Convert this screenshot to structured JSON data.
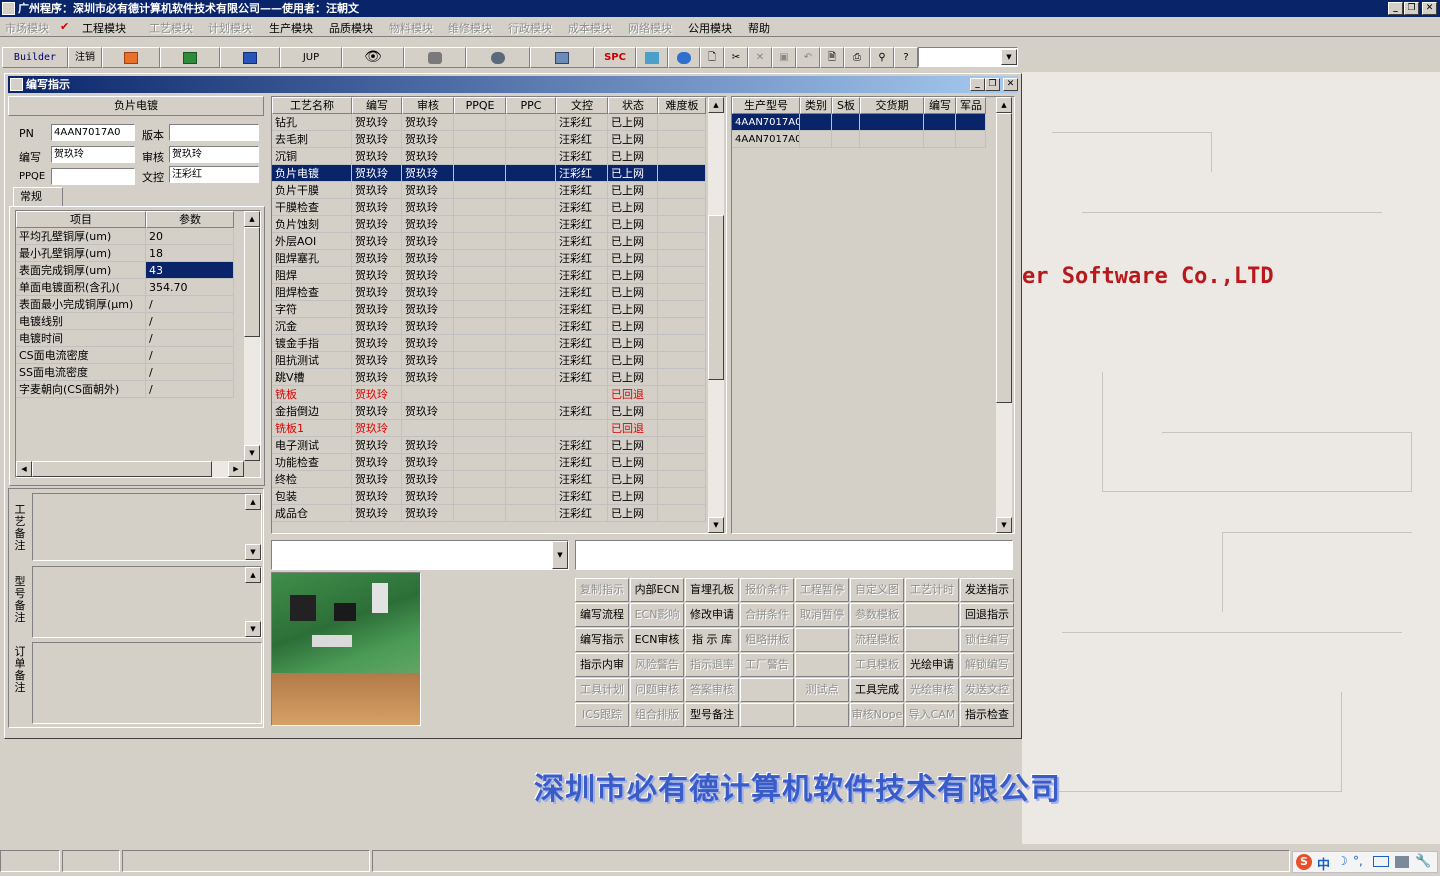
{
  "app": {
    "title": "广州程序：深圳市必有德计算机软件技术有限公司——使用者：汪朝文"
  },
  "menu": [
    {
      "label": "市场模块",
      "enabled": false
    },
    {
      "label": "工程模块",
      "enabled": true,
      "checked": true
    },
    {
      "label": "工艺模块",
      "enabled": false
    },
    {
      "label": "计划模块",
      "enabled": false
    },
    {
      "label": "生产模块",
      "enabled": true
    },
    {
      "label": "品质模块",
      "enabled": true
    },
    {
      "label": "物料模块",
      "enabled": false
    },
    {
      "label": "维修模块",
      "enabled": false
    },
    {
      "label": "行政模块",
      "enabled": false
    },
    {
      "label": "成本模块",
      "enabled": false
    },
    {
      "label": "网络模块",
      "enabled": false
    },
    {
      "label": "公用模块",
      "enabled": true
    },
    {
      "label": "帮助",
      "enabled": true
    }
  ],
  "toolbar": {
    "builder": "Builder",
    "logout": "注销",
    "jup": "JUP",
    "spc": "SPC"
  },
  "child": {
    "title": "编写指示",
    "panel_title": "负片电镀",
    "pn_label": "PN",
    "pn_value": "4AAN7017A0",
    "version_label": "版本",
    "version_value": "",
    "writer_label": "编写",
    "writer_value": "贺玖玲",
    "review_label": "审核",
    "review_value": "贺玖玲",
    "ppqe_label": "PPQE",
    "ppqe_value": "",
    "doc_label": "文控",
    "doc_value": "汪彩红",
    "tab_general": "常规"
  },
  "params": {
    "headers": [
      "项目",
      "参数"
    ],
    "rows": [
      [
        "平均孔壁铜厚(um)",
        "20"
      ],
      [
        "最小孔壁铜厚(um)",
        "18"
      ],
      [
        "表面完成铜厚(um)",
        "43"
      ],
      [
        "单面电镀面积(含孔)(",
        "354.70"
      ],
      [
        "表面最小完成铜厚(μm)",
        "/"
      ],
      [
        "电镀线别",
        "/"
      ],
      [
        "电镀时间",
        "/"
      ],
      [
        "CS面电流密度",
        "/"
      ],
      [
        "SS面电流密度",
        "/"
      ],
      [
        "字麦朝向(CS面朝外)",
        "/"
      ]
    ]
  },
  "remarks": {
    "process": "工艺备注",
    "model": "型号备注",
    "order": "订单备注"
  },
  "process_grid": {
    "headers": [
      "工艺名称",
      "编写",
      "审核",
      "PPQE",
      "PPC",
      "文控",
      "状态",
      "难度板"
    ],
    "rows": [
      [
        "钻孔",
        "贺玖玲",
        "贺玖玲",
        "",
        "",
        "汪彩红",
        "已上网",
        ""
      ],
      [
        "去毛刺",
        "贺玖玲",
        "贺玖玲",
        "",
        "",
        "汪彩红",
        "已上网",
        ""
      ],
      [
        "沉铜",
        "贺玖玲",
        "贺玖玲",
        "",
        "",
        "汪彩红",
        "已上网",
        ""
      ],
      [
        "负片电镀",
        "贺玖玲",
        "贺玖玲",
        "",
        "",
        "汪彩红",
        "已上网",
        ""
      ],
      [
        "负片干膜",
        "贺玖玲",
        "贺玖玲",
        "",
        "",
        "汪彩红",
        "已上网",
        ""
      ],
      [
        "干膜检查",
        "贺玖玲",
        "贺玖玲",
        "",
        "",
        "汪彩红",
        "已上网",
        ""
      ],
      [
        "负片蚀刻",
        "贺玖玲",
        "贺玖玲",
        "",
        "",
        "汪彩红",
        "已上网",
        ""
      ],
      [
        "外层AOI",
        "贺玖玲",
        "贺玖玲",
        "",
        "",
        "汪彩红",
        "已上网",
        ""
      ],
      [
        "阻焊塞孔",
        "贺玖玲",
        "贺玖玲",
        "",
        "",
        "汪彩红",
        "已上网",
        ""
      ],
      [
        "阻焊",
        "贺玖玲",
        "贺玖玲",
        "",
        "",
        "汪彩红",
        "已上网",
        ""
      ],
      [
        "阻焊检查",
        "贺玖玲",
        "贺玖玲",
        "",
        "",
        "汪彩红",
        "已上网",
        ""
      ],
      [
        "字符",
        "贺玖玲",
        "贺玖玲",
        "",
        "",
        "汪彩红",
        "已上网",
        ""
      ],
      [
        "沉金",
        "贺玖玲",
        "贺玖玲",
        "",
        "",
        "汪彩红",
        "已上网",
        ""
      ],
      [
        "镀金手指",
        "贺玖玲",
        "贺玖玲",
        "",
        "",
        "汪彩红",
        "已上网",
        ""
      ],
      [
        "阻抗测试",
        "贺玖玲",
        "贺玖玲",
        "",
        "",
        "汪彩红",
        "已上网",
        ""
      ],
      [
        "跳V槽",
        "贺玖玲",
        "贺玖玲",
        "",
        "",
        "汪彩红",
        "已上网",
        ""
      ],
      [
        "铣板",
        "贺玖玲",
        "",
        "",
        "",
        "",
        "已回退",
        ""
      ],
      [
        "金指倒边",
        "贺玖玲",
        "贺玖玲",
        "",
        "",
        "汪彩红",
        "已上网",
        ""
      ],
      [
        "铣板1",
        "贺玖玲",
        "",
        "",
        "",
        "",
        "已回退",
        ""
      ],
      [
        "电子测试",
        "贺玖玲",
        "贺玖玲",
        "",
        "",
        "汪彩红",
        "已上网",
        ""
      ],
      [
        "功能检查",
        "贺玖玲",
        "贺玖玲",
        "",
        "",
        "汪彩红",
        "已上网",
        ""
      ],
      [
        "终检",
        "贺玖玲",
        "贺玖玲",
        "",
        "",
        "汪彩红",
        "已上网",
        ""
      ],
      [
        "包装",
        "贺玖玲",
        "贺玖玲",
        "",
        "",
        "汪彩红",
        "已上网",
        ""
      ],
      [
        "成品仓",
        "贺玖玲",
        "贺玖玲",
        "",
        "",
        "汪彩红",
        "已上网",
        ""
      ]
    ]
  },
  "model_grid": {
    "headers": [
      "生产型号",
      "类别",
      "S板",
      "交货期",
      "编写",
      "军品"
    ],
    "rows": [
      [
        "4AAN7017A0",
        "",
        "",
        "",
        "",
        ""
      ],
      [
        "4AAN7017A0",
        "",
        "",
        "",
        "",
        ""
      ]
    ]
  },
  "actions": [
    [
      "复制指示",
      "内部ECN",
      "盲埋孔板",
      "报价条件",
      "工程暂停",
      "自定义图",
      "工艺计时",
      "发送指示"
    ],
    [
      "编写流程",
      "ECN影响",
      "修改申请",
      "合拼条件",
      "取消暂停",
      "参数模板",
      "",
      "回退指示"
    ],
    [
      "编写指示",
      "ECN审核",
      "指 示 库",
      "粗略拼板",
      "",
      "流程模板",
      "",
      "锁住编写"
    ],
    [
      "指示内审",
      "风险警告",
      "指示退率",
      "工厂警告",
      "",
      "工具模板",
      "光绘申请",
      "解锁编写"
    ],
    [
      "工具计划",
      "问题审核",
      "答案审核",
      "",
      "测试点",
      "工具完成",
      "光绘审核",
      "发送文控"
    ],
    [
      "ICS跟踪",
      "组合排版",
      "型号备注",
      "",
      "",
      "审核Nope",
      "导入CAM",
      "指示检查"
    ]
  ],
  "actions_enabled": [
    [
      0,
      1,
      1,
      0,
      0,
      0,
      0,
      1
    ],
    [
      1,
      0,
      1,
      0,
      0,
      0,
      0,
      1
    ],
    [
      1,
      1,
      1,
      0,
      0,
      0,
      0,
      0
    ],
    [
      1,
      0,
      0,
      0,
      0,
      0,
      1,
      0
    ],
    [
      0,
      0,
      0,
      0,
      0,
      1,
      0,
      0
    ],
    [
      0,
      0,
      1,
      0,
      0,
      0,
      0,
      1
    ]
  ],
  "brand": {
    "software": "er Software Co.,LTD",
    "company": "深圳市必有德计算机软件技术有限公司"
  },
  "tray": {
    "ime": "中"
  },
  "colors": {
    "titlebar": "#0a246a",
    "selection": "#0a246a",
    "rollback": "#e00000",
    "brand_red": "#b8191c",
    "company_blue": "#3a5cc8"
  }
}
